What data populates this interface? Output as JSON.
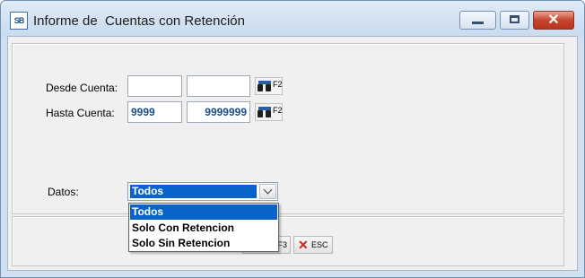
{
  "window": {
    "title": "Informe de  Cuentas con Retención",
    "icon_text": "SB",
    "close_glyph": "✕"
  },
  "form": {
    "desde_label": "Desde Cuenta:",
    "hasta_label": "Hasta Cuenta:",
    "desde_value_1": "",
    "desde_value_2": "",
    "hasta_value_1": "9999",
    "hasta_value_2": "9999999",
    "lookup_key": "F2",
    "datos_label": "Datos:"
  },
  "datos_combo": {
    "selected": "Todos",
    "options": [
      "Todos",
      "Solo Con Retencion",
      "Solo Sin Retencion"
    ]
  },
  "buttons": {
    "f3_label": "F3",
    "esc_label": "ESC",
    "esc_glyph": "✕"
  },
  "colors": {
    "selection": "#0a63c9",
    "close_button": "#c7442c",
    "field_text": "#1a4d8a"
  }
}
